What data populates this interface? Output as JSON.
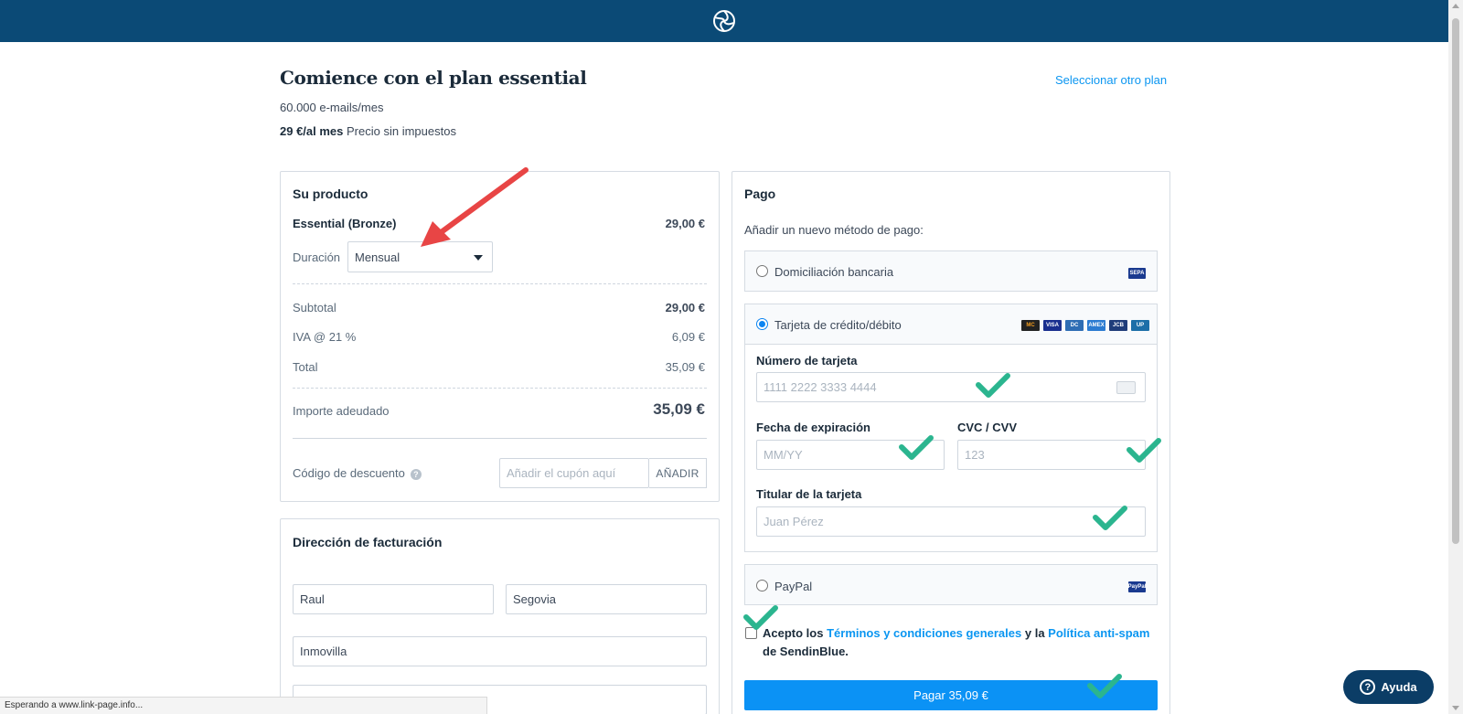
{
  "header": {
    "logo_icon": "sendinblue-logo-icon",
    "bg_color": "#0b4a76"
  },
  "page": {
    "title": "Comience con el plan essential",
    "select_other_plan": "Seleccionar otro plan",
    "emails_per_month": "60.000 e-mails/mes",
    "price_bold": "29 €/al mes",
    "price_note": "Precio sin impuestos"
  },
  "product": {
    "title": "Su producto",
    "item_name": "Essential (Bronze)",
    "item_price": "29,00 €",
    "duration_label": "Duración",
    "duration_value": "Mensual",
    "subtotal_label": "Subtotal",
    "subtotal_value": "29,00 €",
    "vat_label": "IVA @ 21 %",
    "vat_value": "6,09 €",
    "total_label": "Total",
    "total_value": "35,09 €",
    "due_label": "Importe adeudado",
    "due_value": "35,09 €",
    "discount_label": "Código de descuento",
    "discount_placeholder": "Añadir el cupón aquí",
    "discount_button": "AÑADIR"
  },
  "billing": {
    "title": "Dirección de facturación",
    "first_name": "Raul",
    "last_name": "Segovia",
    "company": "Inmovilla"
  },
  "payment": {
    "title": "Pago",
    "add_method_label": "Añadir un nuevo método de pago:",
    "option_bank": "Domiciliación bancaria",
    "option_bank_badge": "SEPA",
    "option_card": "Tarjeta de crédito/débito",
    "card_badges": [
      "MC",
      "VISA",
      "DC",
      "AMEX",
      "JCB",
      "UP"
    ],
    "card_number_label": "Número de tarjeta",
    "card_number_placeholder": "1111 2222 3333 4444",
    "expiry_label": "Fecha de expiración",
    "expiry_placeholder": "MM/YY",
    "cvc_label": "CVC / CVV",
    "cvc_placeholder": "123",
    "holder_label": "Titular de la tarjeta",
    "holder_placeholder": "Juan Pérez",
    "option_paypal": "PayPal",
    "option_paypal_badge": "PayPal",
    "terms_prefix": "Acepto los",
    "terms_link": "Términos y condiciones generales",
    "terms_mid": "y la",
    "spam_link": "Política anti-spam",
    "terms_suffix": "de",
    "terms_company": "SendinBlue.",
    "pay_button": "Pagar 35,09 €"
  },
  "status_bar": "Esperando a www.link-page.info...",
  "help_button": "Ayuda",
  "accent_color": "#0b92f5",
  "annotation_color_arrow": "#e84545",
  "annotation_color_check": "#2bb58f"
}
